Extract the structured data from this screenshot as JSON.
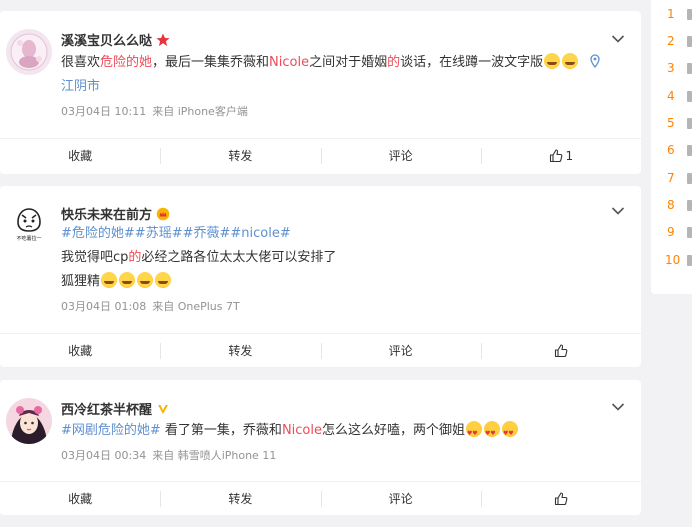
{
  "posts": [
    {
      "username": "溪溪宝贝么么哒",
      "content_parts": [
        "很喜欢",
        "危险的她",
        "，最后一集集乔薇和",
        "Nicole",
        "之间对于婚姻",
        "的",
        "谈话，在线蹲一波文字版"
      ],
      "location": "江阴市",
      "meta": {
        "date": "03月04日 10:11",
        "source": "来自 iPhone客户端"
      },
      "actions": {
        "fav": "收藏",
        "repost": "转发",
        "comment": "评论",
        "likes": "1"
      }
    },
    {
      "username": "快乐未来在前方",
      "tags": [
        "#危险的她#",
        "#苏瑶#",
        "#乔薇#",
        "#nicole#"
      ],
      "line2_parts": [
        "我觉得吧cp",
        "的",
        "必经之路各位太太大佬可以安排了"
      ],
      "line3": "狐狸精",
      "meta": {
        "date": "03月04日 01:08",
        "source": "来自 OnePlus 7T"
      },
      "actions": {
        "fav": "收藏",
        "repost": "转发",
        "comment": "评论",
        "likes": ""
      }
    },
    {
      "username": "西冷红茶半杯醒",
      "tag": "#网剧危险的她#",
      "content_parts": [
        " 看了第一集，乔薇和",
        "Nicole",
        "怎么这么好嗑，两个御姐"
      ],
      "meta": {
        "date": "03月04日 00:34",
        "source": "来自 韩雪喷人iPhone 11"
      },
      "actions": {
        "fav": "收藏",
        "repost": "转发",
        "comment": "评论",
        "likes": ""
      }
    }
  ],
  "ranks": [
    "1",
    "2",
    "3",
    "4",
    "5",
    "6",
    "7",
    "8",
    "9",
    "10"
  ],
  "colors": {
    "accent_red": "#eb4c59",
    "link_blue": "#5d8fcf",
    "rank_orange": "#ff8200"
  }
}
